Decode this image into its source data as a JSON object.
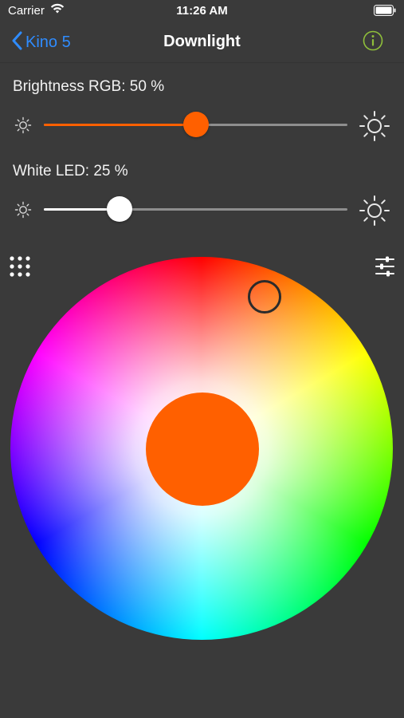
{
  "status": {
    "carrier": "Carrier",
    "time": "11:26 AM"
  },
  "nav": {
    "back_label": "Kino 5",
    "title": "Downlight"
  },
  "brightness": {
    "label": "Brightness RGB: 50 %",
    "value_percent": 50,
    "fill_color": "#ff6000"
  },
  "white_led": {
    "label": "White LED: 25 %",
    "value_percent": 25,
    "fill_color": "#ffffff"
  },
  "color_picker": {
    "selected_color": "#ff6000",
    "handle_hue": "orange-red"
  },
  "colors": {
    "accent_blue": "#2f8cff",
    "info_green": "#8fbf3a",
    "background": "#3a3a3a"
  },
  "icons": [
    "wifi-icon",
    "battery-icon",
    "chevron-left-icon",
    "info-icon",
    "sun-small-icon",
    "sun-large-icon",
    "grid-dots-icon",
    "sliders-icon"
  ]
}
